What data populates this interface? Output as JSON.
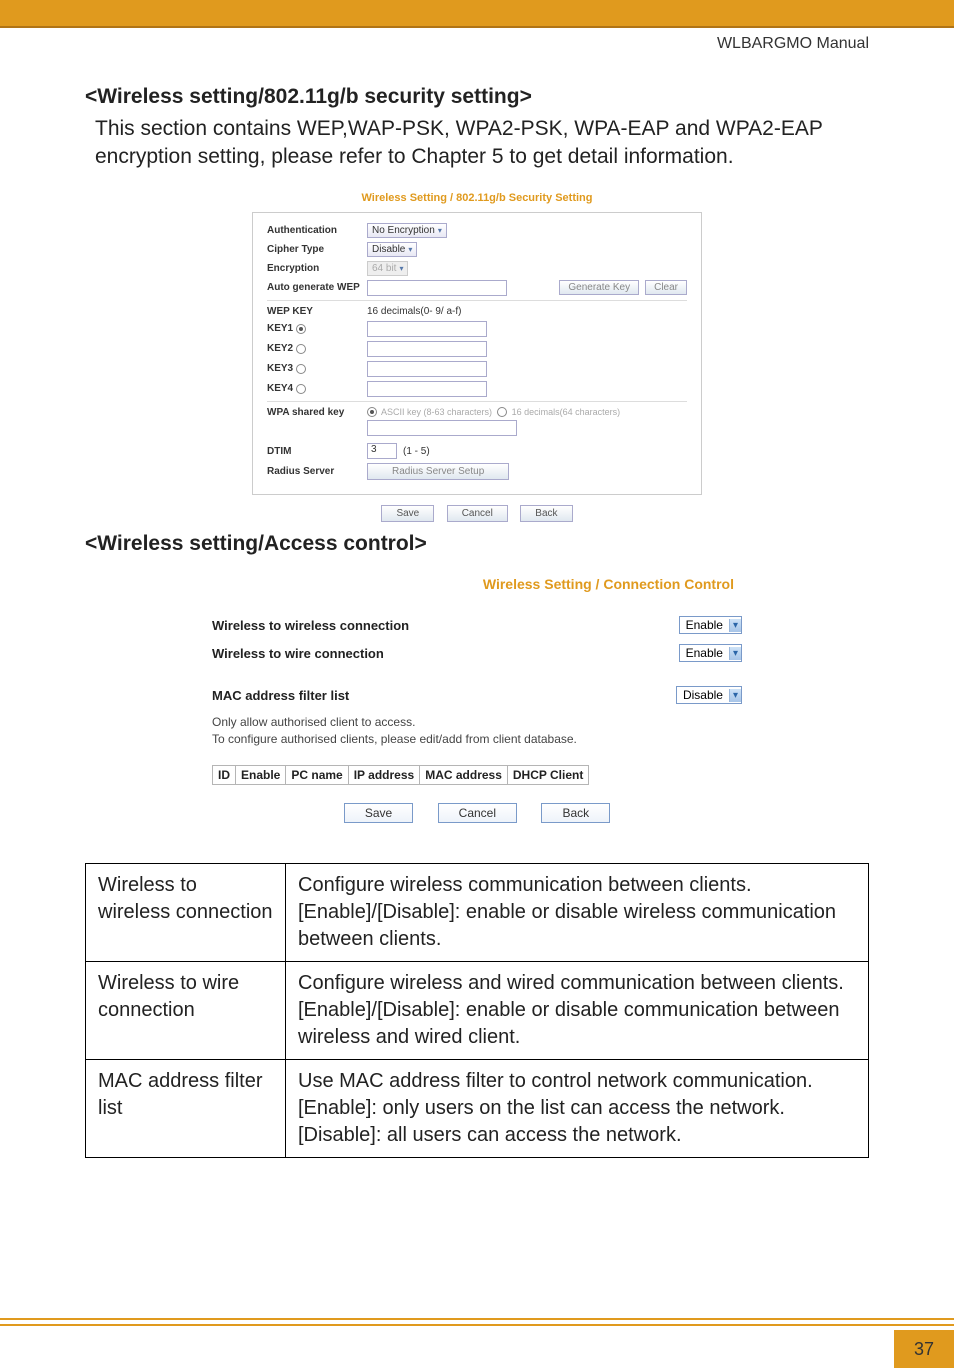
{
  "header": {
    "manual": "WLBARGMO Manual"
  },
  "section1": {
    "title": "<Wireless setting/802.11g/b security setting>",
    "text": "This section contains WEP,WAP-PSK, WPA2-PSK, WPA-EAP and WPA2-EAP encryption setting, please refer to Chapter 5 to get detail information."
  },
  "sec_box": {
    "title": "Wireless Setting / 802.11g/b Security Setting",
    "auth_label": "Authentication",
    "auth_val": "No Encryption",
    "cipher_label": "Cipher Type",
    "cipher_val": "Disable",
    "enc_label": "Encryption",
    "enc_val": "64 bit",
    "autogen_label": "Auto generate WEP",
    "gen_btn": "Generate Key",
    "clear_btn": "Clear",
    "wep_label": "WEP KEY",
    "wep_hint": "16 decimals(0- 9/ a-f)",
    "key1": "KEY1",
    "key2": "KEY2",
    "key3": "KEY3",
    "key4": "KEY4",
    "wpa_label": "WPA shared key",
    "wpa_r1": "ASCII key (8-63 characters)",
    "wpa_r2": "16 decimals(64 characters)",
    "dtim_label": "DTIM",
    "dtim_val": "3",
    "dtim_range": "(1 - 5)",
    "radius_label": "Radius Server",
    "radius_btn": "Radius Server Setup",
    "save": "Save",
    "cancel": "Cancel",
    "back": "Back"
  },
  "section2": {
    "title": "<Wireless setting/Access control>"
  },
  "conn": {
    "title": "Wireless Setting / Connection Control",
    "w2w_label": "Wireless to wireless connection",
    "w2w_val": "Enable",
    "w2wire_label": "Wireless to wire connection",
    "w2wire_val": "Enable",
    "mac_label": "MAC address filter list",
    "mac_val": "Disable",
    "note1": "Only allow authorised client to access.",
    "note2": "To configure authorised clients, please edit/add from client database.",
    "tbl": {
      "c1": "ID",
      "c2": "Enable",
      "c3": "PC name",
      "c4": "IP address",
      "c5": "MAC address",
      "c6": "DHCP Client"
    },
    "save": "Save",
    "cancel": "Cancel",
    "back": "Back"
  },
  "def": [
    {
      "left": "Wireless to wireless connection",
      "right": "Configure wireless communication between clients. [Enable]/[Disable]: enable or disable wireless communication between clients."
    },
    {
      "left": "Wireless to wire connection",
      "right": "Configure wireless and wired communication between clients.\n[Enable]/[Disable]: enable or disable communication between wireless and wired client."
    },
    {
      "left": "MAC address filter list",
      "right": "Use MAC address filter to control network communication.\n[Enable]: only users on the list can access the network.\n[Disable]: all users can access the network."
    }
  ],
  "page": "37"
}
